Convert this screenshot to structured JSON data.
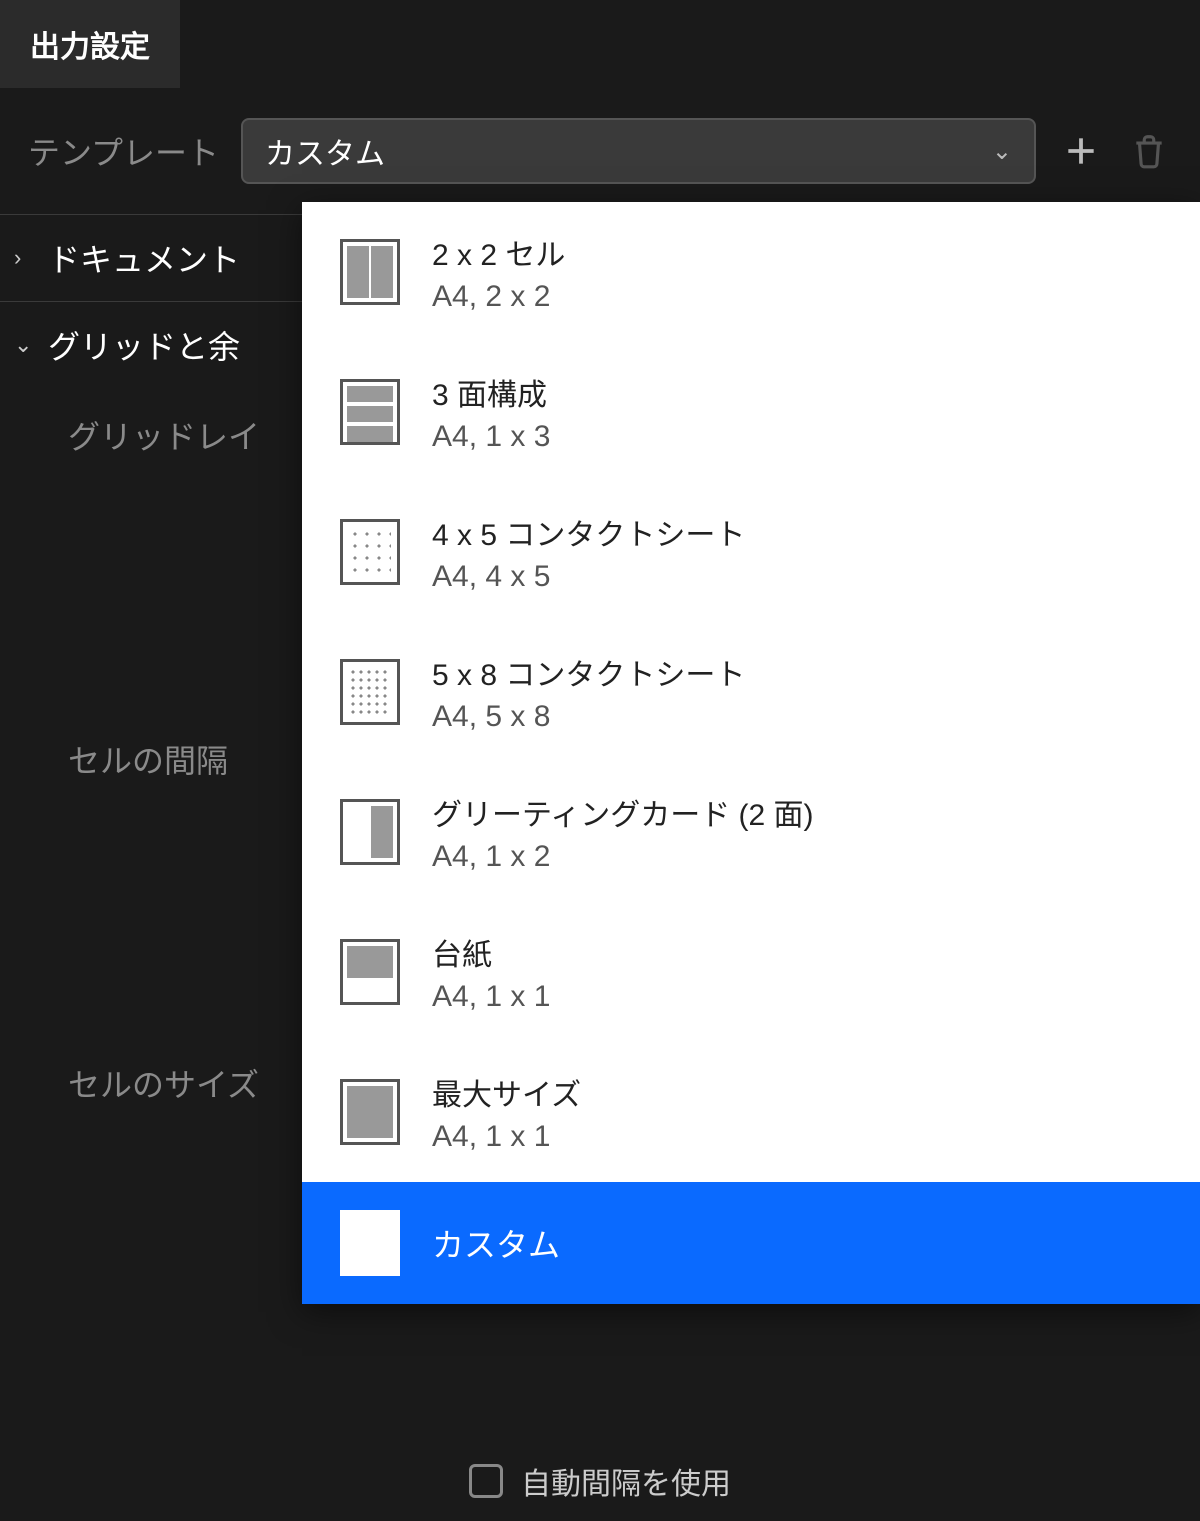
{
  "tab": {
    "title": "出力設定"
  },
  "template": {
    "label": "テンプレート",
    "selected": "カスタム"
  },
  "sections": {
    "document": "ドキュメント",
    "grid_margins": "グリッドと余",
    "grid_layout": "グリッドレイ",
    "cell_spacing": "セルの間隔",
    "cell_size": "セルのサイズ"
  },
  "dropdown": {
    "items": [
      {
        "title": "2 x 2 セル",
        "sub": "A4, 2 x 2"
      },
      {
        "title": "3 面構成",
        "sub": "A4, 1 x 3"
      },
      {
        "title": "4 x 5 コンタクトシート",
        "sub": "A4, 4 x 5"
      },
      {
        "title": "5 x 8 コンタクトシート",
        "sub": "A4, 5 x 8"
      },
      {
        "title": "グリーティングカード (2 面)",
        "sub": "A4, 1 x 2"
      },
      {
        "title": "台紙",
        "sub": "A4, 1 x 1"
      },
      {
        "title": "最大サイズ",
        "sub": "A4, 1 x 1"
      },
      {
        "title": "カスタム",
        "sub": ""
      }
    ]
  },
  "footer": {
    "auto_spacing": "自動間隔を使用"
  }
}
